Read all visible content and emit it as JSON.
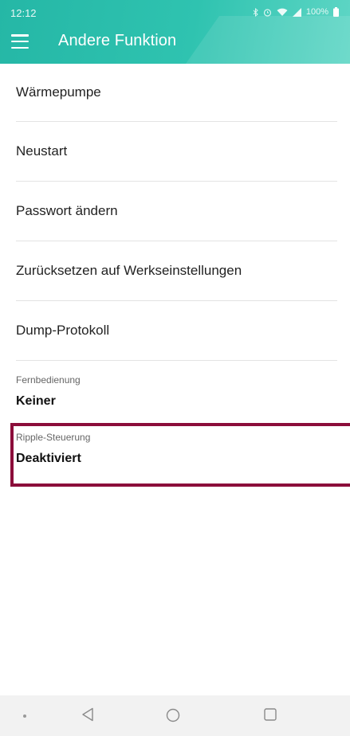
{
  "status_bar": {
    "time": "12:12",
    "battery": "100%",
    "icons": [
      "bluetooth-icon",
      "alarm-icon",
      "wifi-icon",
      "signal-icon",
      "battery-icon"
    ]
  },
  "app_bar": {
    "title": "Andere Funktion",
    "menu_icon": "hamburger-menu-icon",
    "color": "#2fbfab"
  },
  "menu_items": [
    {
      "label": "Wärmepumpe"
    },
    {
      "label": "Neustart"
    },
    {
      "label": "Passwort ändern"
    },
    {
      "label": "Zurücksetzen auf Werkseinstellungen"
    },
    {
      "label": "Dump-Protokoll"
    }
  ],
  "settings": [
    {
      "caption": "Fernbedienung",
      "value": "Keiner"
    },
    {
      "caption": "Ripple-Steuerung",
      "value": "Deaktiviert"
    }
  ],
  "highlight_color": "#8b0d3a",
  "nav_bar": {
    "icons": [
      "dot-icon",
      "back-icon",
      "home-icon",
      "recents-icon"
    ]
  }
}
